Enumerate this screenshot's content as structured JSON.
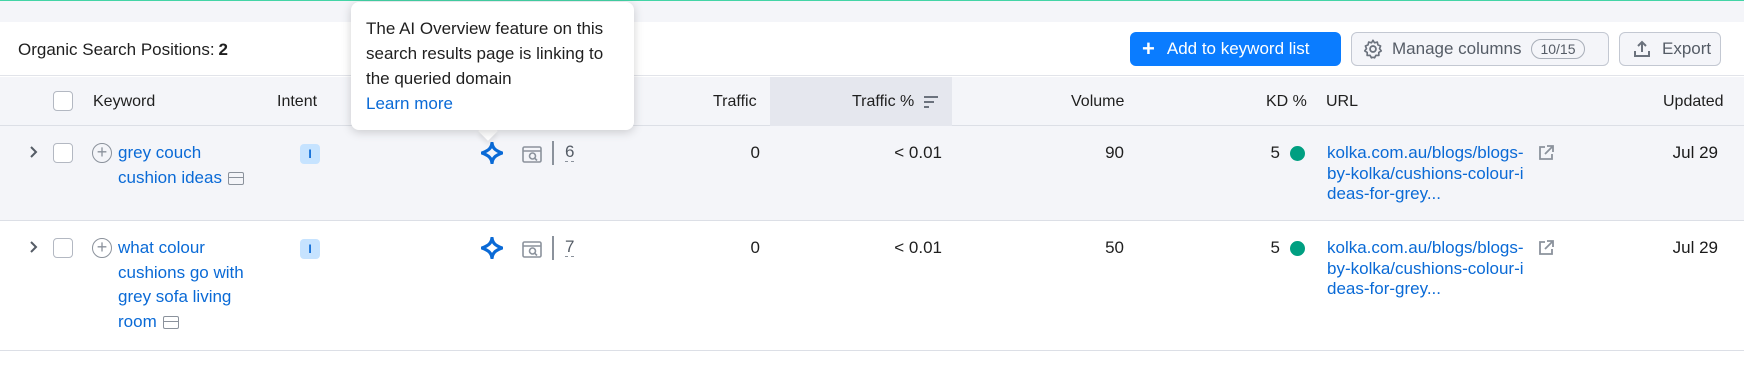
{
  "header": {
    "title_label": "Organic Search Positions:",
    "title_count": "2",
    "add_button": "Add to keyword list",
    "manage_columns": "Manage columns",
    "columns_badge": "10/15",
    "export": "Export"
  },
  "table": {
    "columns": {
      "keyword": "Keyword",
      "intent": "Intent",
      "traffic": "Traffic",
      "traffic_pct": "Traffic %",
      "volume": "Volume",
      "kd": "KD %",
      "url": "URL",
      "updated": "Updated"
    },
    "rows": [
      {
        "keyword": "grey couch cushion ideas",
        "intent": "I",
        "position": "6",
        "traffic": "0",
        "traffic_pct": "< 0.01",
        "volume": "90",
        "kd": "5",
        "url": "kolka.com.au/blogs/blogs-by-kolka/cushions-colour-ideas-for-grey...",
        "updated": "Jul 29"
      },
      {
        "keyword": "what colour cushions go with grey sofa living room",
        "intent": "I",
        "position": "7",
        "traffic": "0",
        "traffic_pct": "< 0.01",
        "volume": "50",
        "kd": "5",
        "url": "kolka.com.au/blogs/blogs-by-kolka/cushions-colour-ideas-for-grey...",
        "updated": "Jul 29"
      }
    ]
  },
  "tooltip": {
    "text": "The AI Overview feature on this search results page is linking to the queried domain",
    "link": "Learn more"
  },
  "colors": {
    "accent": "#0a7cff",
    "link": "#0a6ad6",
    "kd_easy": "#009f81",
    "intent_bg": "#c6e3ff"
  },
  "icons": [
    "plus-icon",
    "gear-icon",
    "export-icon",
    "chevron-right-icon",
    "add-keyword-icon",
    "serp-snapshot-icon",
    "ai-overview-icon",
    "serp-features-icon",
    "external-link-icon",
    "sort-icon"
  ]
}
